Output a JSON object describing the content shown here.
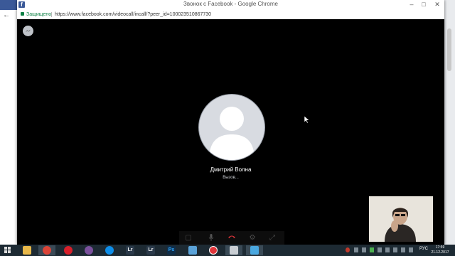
{
  "window": {
    "title": "Звонок с Facebook - Google Chrome",
    "secure_label": "Защищено",
    "url": "https://www.facebook.com/videocall/incall/?peer_id=100023510867730"
  },
  "call": {
    "contact_name": "Дмитрий Волна",
    "status": "Вызов..."
  },
  "taskbar": {
    "language": "РУС",
    "time": "17:59",
    "date": "21.12.2017",
    "apps": [
      "file-explorer",
      "chrome",
      "opera",
      "viber",
      "teamviewer",
      "lightroom",
      "lightroom",
      "photoshop",
      "monitor",
      "screen-recorder",
      "browser-window",
      "screenshot-tool"
    ]
  },
  "colors": {
    "facebook_blue": "#3b5998",
    "secure_green": "#0b8043",
    "hangup_red": "#e0353a",
    "taskbar": "#1d2a33"
  }
}
